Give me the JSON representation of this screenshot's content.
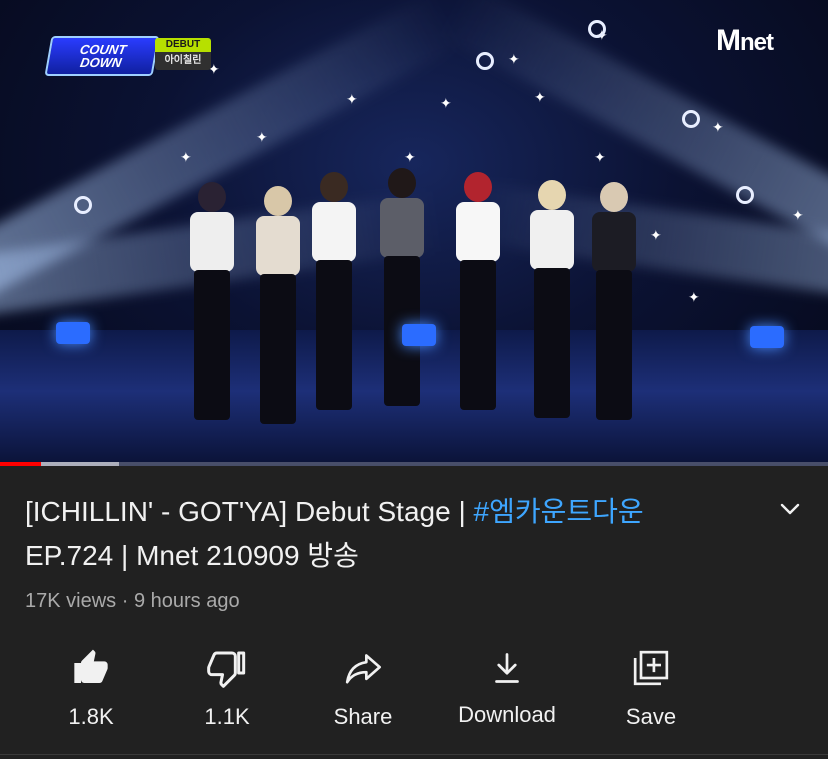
{
  "video": {
    "overlay": {
      "show_logo_line1": "COUNT",
      "show_logo_line2": "DOWN",
      "badge_top": "DEBUT",
      "badge_bottom": "아이칠린",
      "channel_logo": "net",
      "channel_logo_m": "M"
    },
    "progress": {
      "played_fraction": 0.05,
      "buffered_fraction": 0.144,
      "played_color": "#ff0000"
    }
  },
  "title": {
    "text": "[ICHILLIN' - GOT'YA] Debut Stage | ",
    "hashtag": "#엠카운트다운",
    "text_after": "EP.724 | Mnet 210909 방송",
    "hashtag_color": "#3ea6ff"
  },
  "meta": {
    "views": "17K views",
    "separator": " · ",
    "age": "9 hours ago"
  },
  "actions": {
    "like": {
      "label": "1.8K",
      "icon": "thumbs-up-filled-icon"
    },
    "dislike": {
      "label": "1.1K",
      "icon": "thumbs-down-outline-icon"
    },
    "share": {
      "label": "Share",
      "icon": "share-arrow-icon"
    },
    "download": {
      "label": "Download",
      "icon": "download-icon"
    },
    "save": {
      "label": "Save",
      "icon": "add-to-playlist-icon"
    }
  },
  "colors": {
    "background": "#212121",
    "text": "#f1f1f1",
    "secondary_text": "#aaaaaa",
    "accent": "#3ea6ff"
  }
}
